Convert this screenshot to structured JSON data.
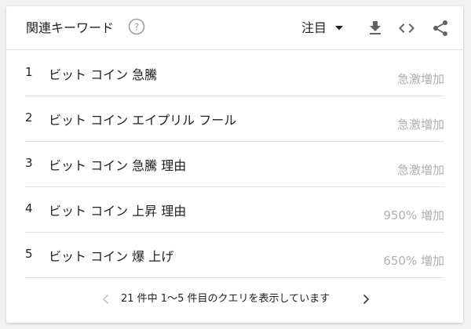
{
  "header": {
    "title": "関連キーワード",
    "filter_label": "注目",
    "icons": [
      "help-icon",
      "dropdown-icon",
      "download-icon",
      "embed-icon",
      "share-icon"
    ]
  },
  "rows": [
    {
      "index": "1",
      "query": "ビット コイン 急騰",
      "value": "急激増加"
    },
    {
      "index": "2",
      "query": "ビット コイン エイプリル フール",
      "value": "急激増加"
    },
    {
      "index": "3",
      "query": "ビット コイン 急騰 理由",
      "value": "急激増加"
    },
    {
      "index": "4",
      "query": "ビット コイン 上昇 理由",
      "value": "950% 増加"
    },
    {
      "index": "5",
      "query": "ビット コイン 爆 上げ",
      "value": "650% 増加"
    }
  ],
  "footer": {
    "pagination_text": "21 件中 1〜5 件目のクエリを表示しています"
  },
  "colors": {
    "text": "#212121",
    "muted": "#b0b0b0",
    "icon": "#5f6368",
    "divider": "#e0e0e0"
  }
}
